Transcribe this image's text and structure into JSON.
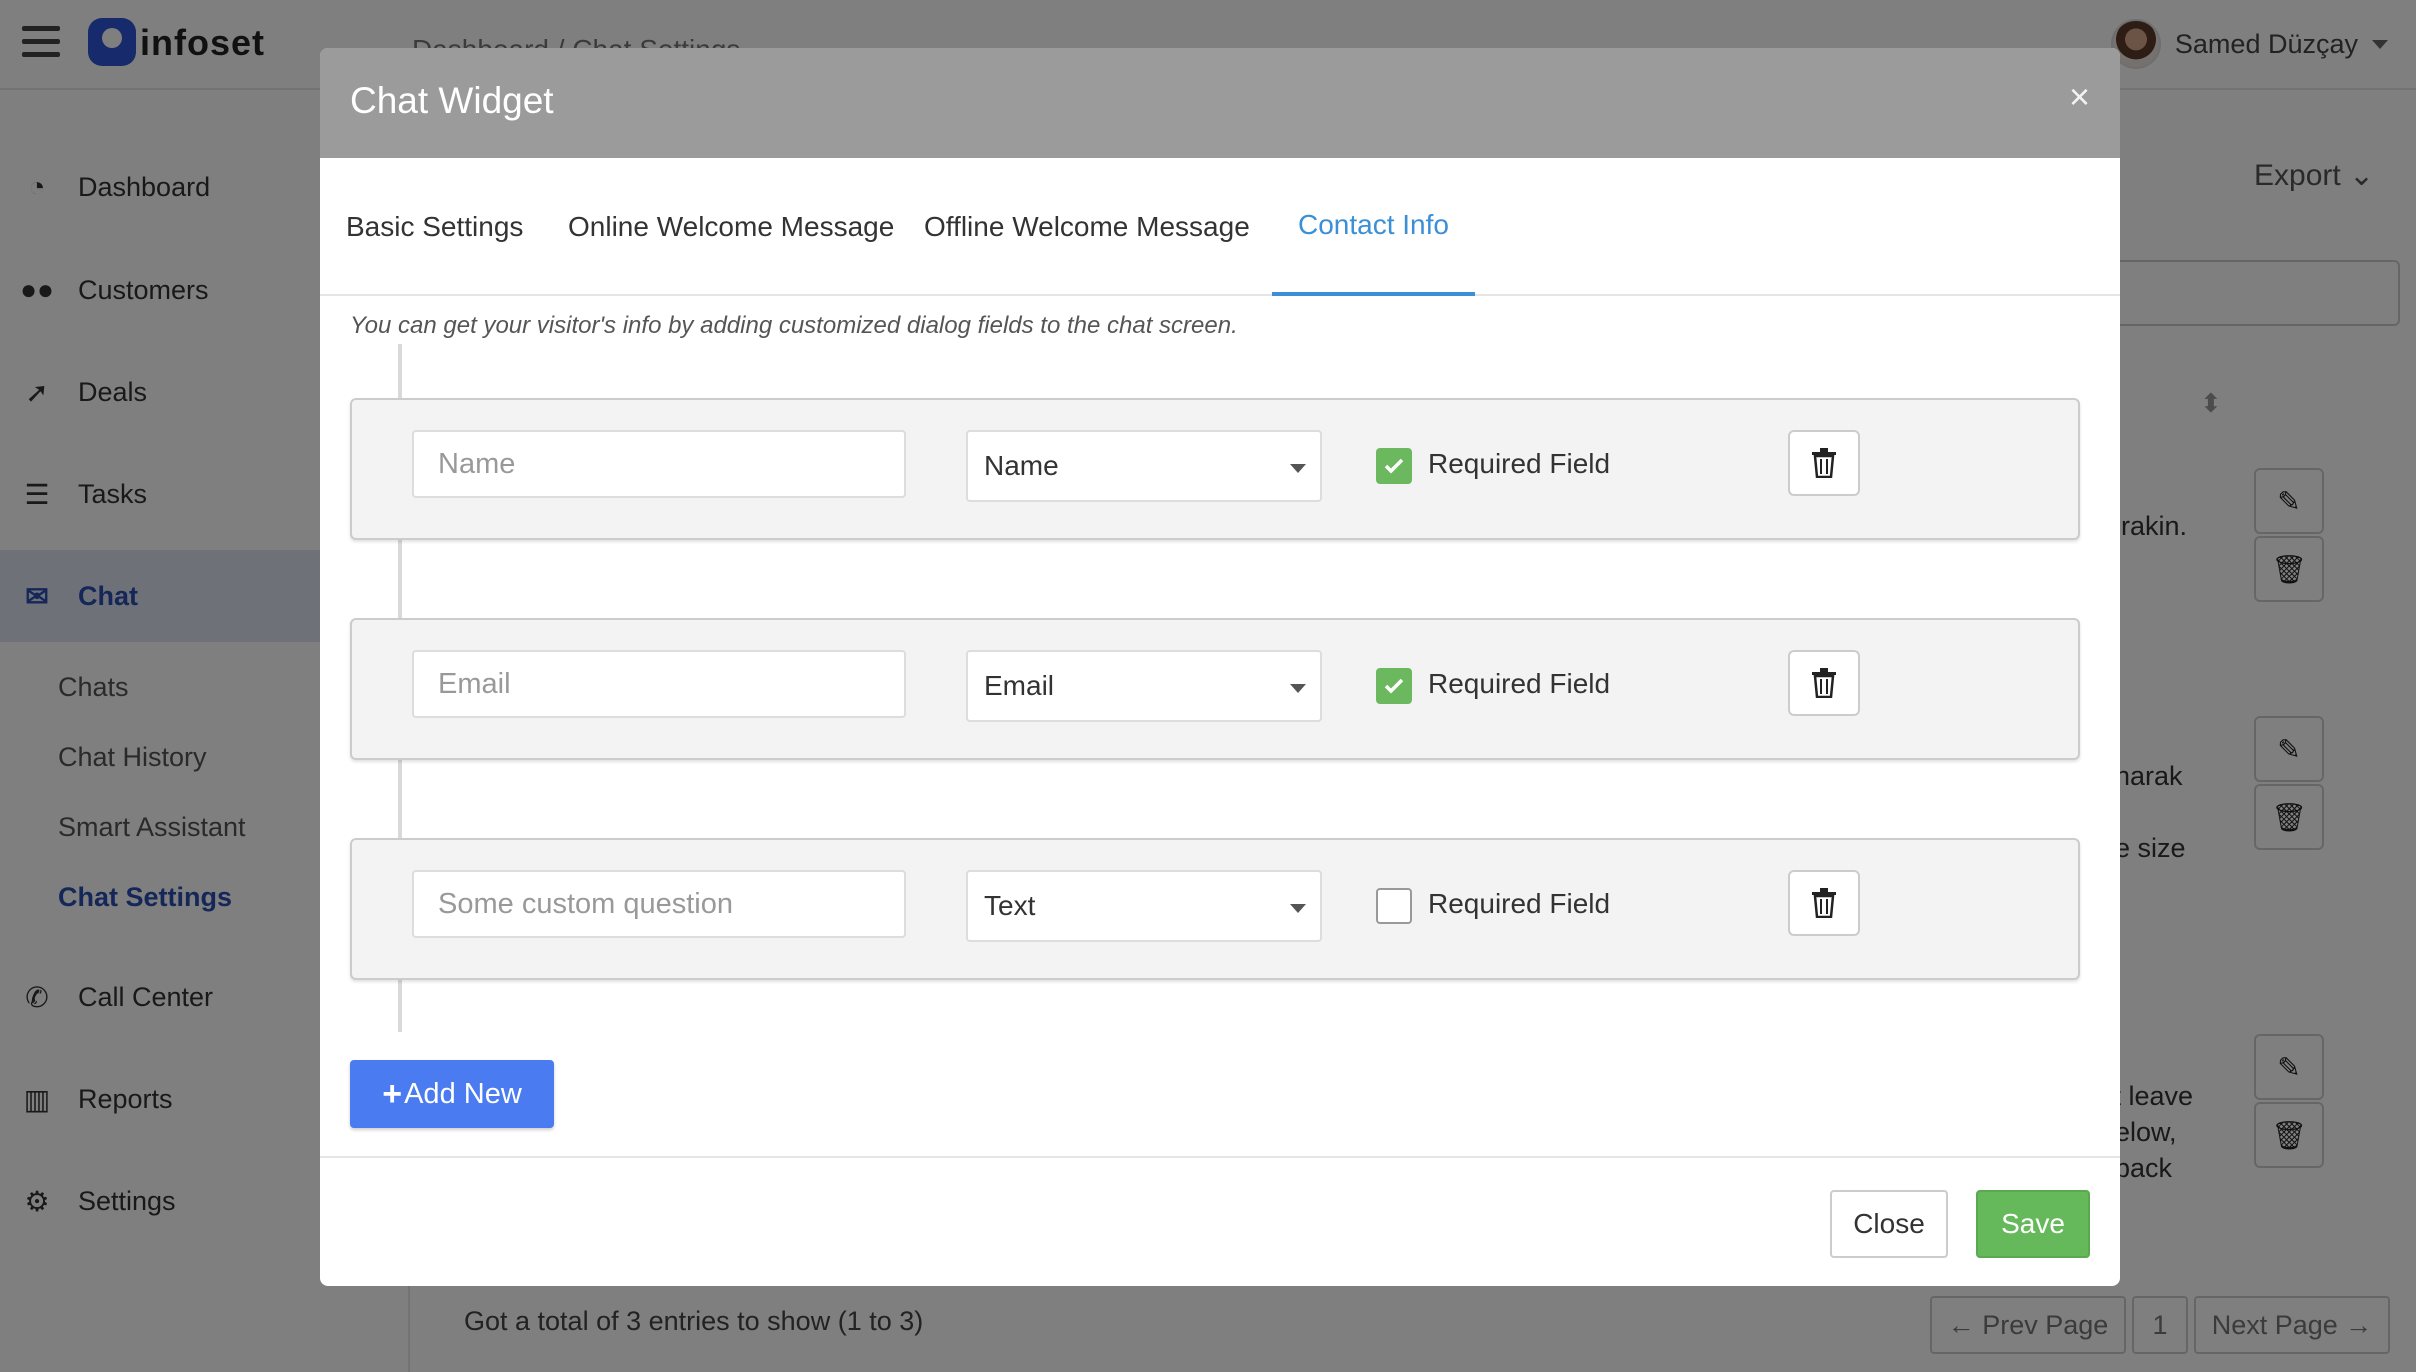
{
  "app": {
    "logo_text": "infoset",
    "breadcrumb": "Dashboard / Chat Settings",
    "user_name": "Samed Düzçay"
  },
  "sidebar": {
    "items": [
      {
        "label": "Dashboard",
        "icon": "dashboard-icon"
      },
      {
        "label": "Customers",
        "icon": "users-icon"
      },
      {
        "label": "Deals",
        "icon": "rocket-icon"
      },
      {
        "label": "Tasks",
        "icon": "list-icon"
      },
      {
        "label": "Chat",
        "icon": "comments-icon"
      },
      {
        "label": "Call Center",
        "icon": "phone-icon"
      },
      {
        "label": "Reports",
        "icon": "bar-chart-icon"
      },
      {
        "label": "Settings",
        "icon": "gears-icon"
      }
    ],
    "chat_sub": [
      "Chats",
      "Chat History",
      "Smart Assistant",
      "Chat Settings"
    ]
  },
  "background": {
    "export_label": "Export",
    "row_texts": [
      "birakin.",
      "anarak",
      "de size",
      "st leave",
      "below,",
      "t back"
    ],
    "footer_count": "Got a total of 3 entries to show (1 to 3)",
    "pager": {
      "prev": "← Prev Page",
      "page": "1",
      "next": "Next Page →"
    }
  },
  "modal": {
    "title": "Chat Widget",
    "close_x": "×",
    "tabs": [
      "Basic Settings",
      "Online Welcome Message",
      "Offline Welcome Message",
      "Contact Info"
    ],
    "active_tab": "Contact Info",
    "intro": "You can get your visitor's info by adding customized dialog fields to the chat screen.",
    "fields": [
      {
        "placeholder": "Name",
        "type": "Name",
        "required": true,
        "required_label": "Required Field"
      },
      {
        "placeholder": "Email",
        "type": "Email",
        "required": true,
        "required_label": "Required Field"
      },
      {
        "placeholder": "Some custom question",
        "type": "Text",
        "required": false,
        "required_label": "Required Field"
      }
    ],
    "add_new_label": "Add New",
    "close_label": "Close",
    "save_label": "Save"
  },
  "colors": {
    "accent_blue": "#3a8fd6",
    "add_button": "#4a7bf0",
    "save_green": "#66b95b",
    "check_green": "#6bb85e",
    "modal_header": "#9b9b9b"
  }
}
